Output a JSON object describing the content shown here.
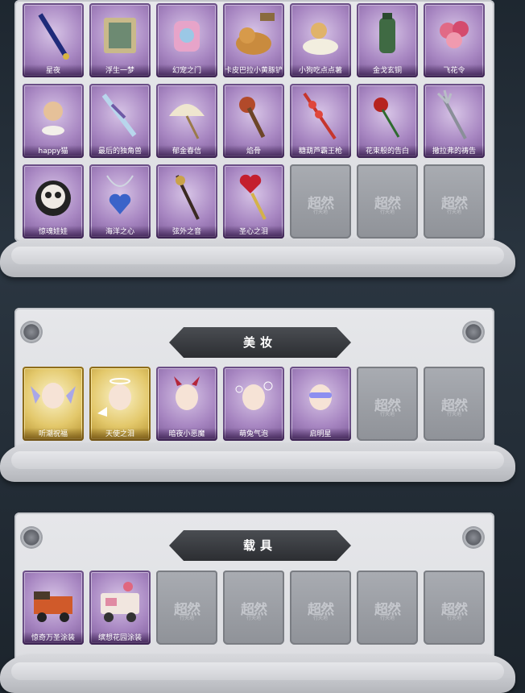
{
  "section1": {
    "items": [
      {
        "name": "星夜",
        "rarity": "purple",
        "icon": "scepter-icon"
      },
      {
        "name": "浮生一梦",
        "rarity": "purple",
        "icon": "hourglass-icon"
      },
      {
        "name": "幻宠之门",
        "rarity": "purple",
        "icon": "gadget-icon"
      },
      {
        "name": "卡皮巴拉小黄豚铲",
        "rarity": "purple",
        "icon": "capybara-icon"
      },
      {
        "name": "小狗吃点点薯",
        "rarity": "purple",
        "icon": "dog-float-icon"
      },
      {
        "name": "金戈玄铜",
        "rarity": "purple",
        "icon": "lantern-icon"
      },
      {
        "name": "飞花令",
        "rarity": "purple",
        "icon": "flower-bouquet-icon"
      },
      {
        "name": "happy猫",
        "rarity": "purple",
        "icon": "cat-figure-icon"
      },
      {
        "name": "最后的独角兽",
        "rarity": "purple",
        "icon": "unicorn-horn-icon"
      },
      {
        "name": "郁金春信",
        "rarity": "purple",
        "icon": "umbrella-icon"
      },
      {
        "name": "焰骨",
        "rarity": "purple",
        "icon": "bone-mace-icon"
      },
      {
        "name": "糖葫芦霸王枪",
        "rarity": "purple",
        "icon": "candy-spear-icon"
      },
      {
        "name": "花束般的告白",
        "rarity": "purple",
        "icon": "rose-icon"
      },
      {
        "name": "撒拉弗的祷告",
        "rarity": "purple",
        "icon": "trident-icon"
      },
      {
        "name": "惊魂娃娃",
        "rarity": "purple",
        "icon": "skull-doll-icon"
      },
      {
        "name": "海洋之心",
        "rarity": "purple",
        "icon": "heart-necklace-icon"
      },
      {
        "name": "弦外之音",
        "rarity": "purple",
        "icon": "music-staff-icon"
      },
      {
        "name": "圣心之泪",
        "rarity": "purple",
        "icon": "heart-wand-icon"
      },
      {
        "name": "",
        "rarity": "empty",
        "icon": "locked-placeholder-icon"
      },
      {
        "name": "",
        "rarity": "empty",
        "icon": "locked-placeholder-icon"
      },
      {
        "name": "",
        "rarity": "empty",
        "icon": "locked-placeholder-icon"
      }
    ]
  },
  "section2": {
    "title": "美妆",
    "items": [
      {
        "name": "听潮祝福",
        "rarity": "gold",
        "icon": "angel-wings-head-icon"
      },
      {
        "name": "天使之泪",
        "rarity": "gold",
        "icon": "halo-head-icon"
      },
      {
        "name": "暗夜小恶魔",
        "rarity": "purple",
        "icon": "devil-head-icon"
      },
      {
        "name": "萌兔气泡",
        "rarity": "purple",
        "icon": "bunny-head-icon"
      },
      {
        "name": "启明星",
        "rarity": "purple",
        "icon": "visor-head-icon"
      },
      {
        "name": "",
        "rarity": "empty",
        "icon": "locked-placeholder-icon"
      },
      {
        "name": "",
        "rarity": "empty",
        "icon": "locked-placeholder-icon"
      }
    ]
  },
  "section3": {
    "title": "载具",
    "items": [
      {
        "name": "惊奇万圣涂装",
        "rarity": "purple",
        "icon": "halloween-truck-icon"
      },
      {
        "name": "缤想花园涂装",
        "rarity": "purple",
        "icon": "flower-van-icon"
      },
      {
        "name": "",
        "rarity": "empty",
        "icon": "locked-placeholder-icon"
      },
      {
        "name": "",
        "rarity": "empty",
        "icon": "locked-placeholder-icon"
      },
      {
        "name": "",
        "rarity": "empty",
        "icon": "locked-placeholder-icon"
      },
      {
        "name": "",
        "rarity": "empty",
        "icon": "locked-placeholder-icon"
      },
      {
        "name": "",
        "rarity": "empty",
        "icon": "locked-placeholder-icon"
      }
    ]
  },
  "placeholder": {
    "mark": "超然",
    "sub": "行天地"
  },
  "colors": {
    "purple": "#a887c2",
    "gold": "#e3c86b",
    "empty": "#9a9da3",
    "panel": "#e0e1e4"
  }
}
